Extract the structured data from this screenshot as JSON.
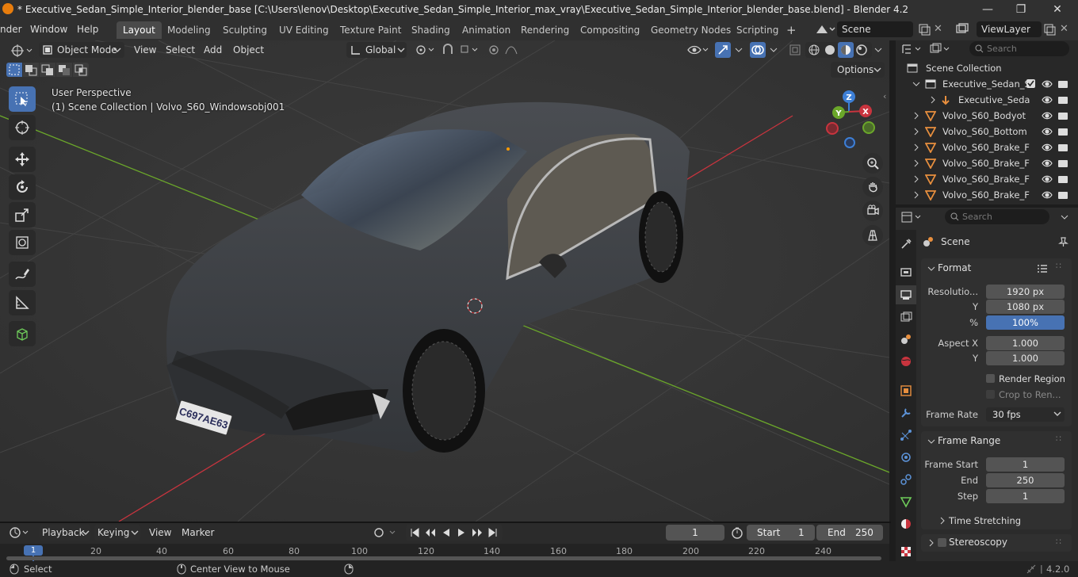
{
  "titlebar": {
    "title": "* Executive_Sedan_Simple_Interior_blender_base [C:\\Users\\lenov\\Desktop\\Executive_Sedan_Simple_Interior_max_vray\\Executive_Sedan_Simple_Interior_blender_base.blend] - Blender 4.2",
    "minimize": "—",
    "maximize": "❐",
    "close": "✕"
  },
  "menubar": {
    "menus": [
      "nder",
      "Window",
      "Help"
    ],
    "workspaces": [
      "Layout",
      "Modeling",
      "Sculpting",
      "UV Editing",
      "Texture Paint",
      "Shading",
      "Animation",
      "Rendering",
      "Compositing",
      "Geometry Nodes",
      "Scripting"
    ],
    "active_workspace": "Layout",
    "add_workspace": "+",
    "scene_name": "Scene",
    "view_layer": "ViewLayer"
  },
  "viewport_header": {
    "mode": "Object Mode",
    "menus": [
      "View",
      "Select",
      "Add",
      "Object"
    ],
    "orientation": "Global",
    "options_label": "Options"
  },
  "viewport": {
    "perspective": "User Perspective",
    "collection_info": "(1) Scene Collection | Volvo_S60_Windowsobj001",
    "license_plate": "C697AE63",
    "gizmo": {
      "x": "X",
      "y": "Y",
      "z": "Z"
    }
  },
  "outliner": {
    "search_placeholder": "Search",
    "root": "Scene Collection",
    "rows": [
      {
        "label": "Executive_Sedan_S",
        "type": "collection"
      },
      {
        "label": "Executive_Seda",
        "type": "armature"
      },
      {
        "label": "Volvo_S60_Bodyot",
        "type": "mesh"
      },
      {
        "label": "Volvo_S60_Bottom",
        "type": "mesh"
      },
      {
        "label": "Volvo_S60_Brake_F",
        "type": "mesh"
      },
      {
        "label": "Volvo_S60_Brake_F",
        "type": "mesh"
      },
      {
        "label": "Volvo_S60_Brake_F",
        "type": "mesh"
      },
      {
        "label": "Volvo_S60_Brake_F",
        "type": "mesh"
      }
    ]
  },
  "properties": {
    "search_placeholder": "Search",
    "context": "Scene",
    "format": {
      "title": "Format",
      "resolution_label": "Resolutio...",
      "resolution_x": "1920 px",
      "y_label": "Y",
      "resolution_y": "1080 px",
      "percent_label": "%",
      "percent": "100%",
      "aspect_x_label": "Aspect X",
      "aspect_x": "1.000",
      "aspect_y_label": "Y",
      "aspect_y": "1.000",
      "render_region": "Render Region",
      "crop": "Crop to Ren...",
      "frame_rate_label": "Frame Rate",
      "frame_rate": "30 fps"
    },
    "frame_range": {
      "title": "Frame Range",
      "start_label": "Frame Start",
      "start": "1",
      "end_label": "End",
      "end": "250",
      "step_label": "Step",
      "step": "1",
      "time_stretching": "Time Stretching"
    },
    "stereoscopy": "Stereoscopy"
  },
  "timeline": {
    "menus": [
      "Playback",
      "Keying",
      "View",
      "Marker"
    ],
    "current_frame": "1",
    "start_label": "Start",
    "start": "1",
    "end_label": "End",
    "end": "250",
    "ruler": [
      "1",
      "20",
      "40",
      "60",
      "80",
      "100",
      "120",
      "140",
      "160",
      "180",
      "200",
      "220",
      "240"
    ]
  },
  "statusbar": {
    "select": "Select",
    "center_view": "Center View to Mouse",
    "version": "4.2.0"
  },
  "colors": {
    "accent": "#4772b3",
    "blender_orange": "#e87d0d",
    "x_axis": "#c8343e",
    "y_axis": "#6ba72a",
    "z_axis": "#3d7fd6"
  }
}
